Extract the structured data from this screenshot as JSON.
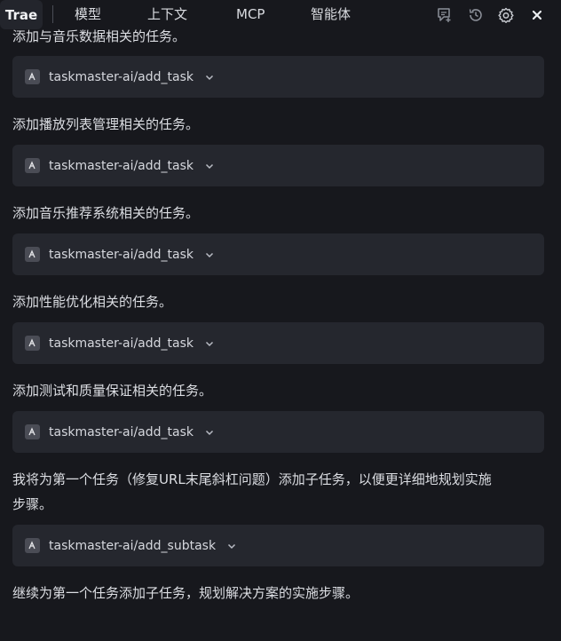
{
  "topbar": {
    "brand": "Trae",
    "tabs": [
      "模型",
      "上下文",
      "MCP",
      "智能体"
    ],
    "icons": [
      "new-chat-icon",
      "history-icon",
      "settings-icon",
      "close-icon"
    ]
  },
  "messages": {
    "partial_top": "添加与音乐数据相关的任务。",
    "p1": "添加播放列表管理相关的任务。",
    "p2": "添加音乐推荐系统相关的任务。",
    "p3": "添加性能优化相关的任务。",
    "p4": "添加测试和质量保证相关的任务。",
    "p5_line1": "我将为第一个任务（修复URL末尾斜杠问题）添加子任务，以便更详细地规划实施",
    "p5_line2": "步骤。",
    "p6": "继续为第一个任务添加子任务，规划解决方案的实施步骤。"
  },
  "tools": {
    "t0": "taskmaster-ai/add_task",
    "t1": "taskmaster-ai/add_task",
    "t2": "taskmaster-ai/add_task",
    "t3": "taskmaster-ai/add_task",
    "t4": "taskmaster-ai/add_task",
    "t5": "taskmaster-ai/add_subtask"
  },
  "colors": {
    "background": "#17181d",
    "card": "#25272e",
    "text": "#dcdee3"
  }
}
